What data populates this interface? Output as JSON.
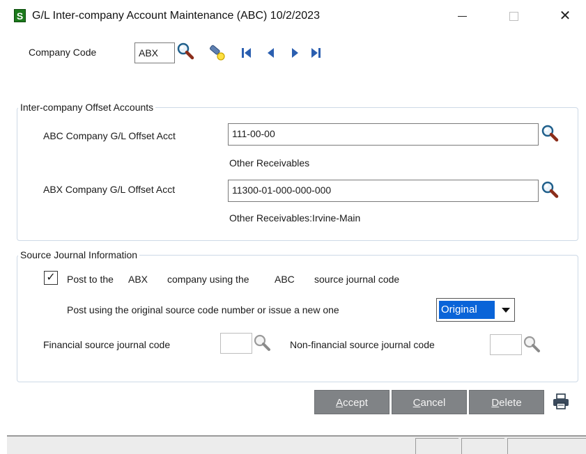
{
  "window": {
    "title": "G/L Inter-company Account Maintenance (ABC) 10/2/2023",
    "app_icon_letter": "S",
    "minimize_symbol": "",
    "maximize_symbol": "",
    "close_symbol": "✕"
  },
  "header": {
    "company_code_label": "Company Code",
    "company_code_value": "ABX"
  },
  "offset_accounts": {
    "legend": "Inter-company Offset Accounts",
    "rows": [
      {
        "label": "ABC  Company G/L Offset Acct",
        "value": "111-00-00",
        "description": "Other Receivables"
      },
      {
        "label": "ABX  Company G/L Offset Acct",
        "value": "11300-01-000-000-000",
        "description": "Other Receivables:Irvine-Main"
      }
    ]
  },
  "source_journal": {
    "legend": "Source Journal Information",
    "post_checkbox_checked": true,
    "post_checkmark": "✓",
    "post_label_1": "Post to the",
    "post_company": "ABX",
    "post_label_2": "company using the",
    "post_source_company": "ABC",
    "post_label_3": "source journal code",
    "post_using_label": "Post using the original source code number or issue a new one",
    "post_using_value": "Original",
    "financial_label": "Financial source journal code",
    "financial_value": "",
    "nonfinancial_label": "Non-financial source journal  code",
    "nonfinancial_value": ""
  },
  "buttons": {
    "accept_ul": "A",
    "accept_rest": "ccept",
    "cancel_ul": "C",
    "cancel_rest": "ancel",
    "delete_ul": "D",
    "delete_rest": "elete"
  },
  "colors": {
    "accent": "#0a64d8",
    "button_bg": "#808386",
    "app_icon": "#1c7a1c"
  }
}
